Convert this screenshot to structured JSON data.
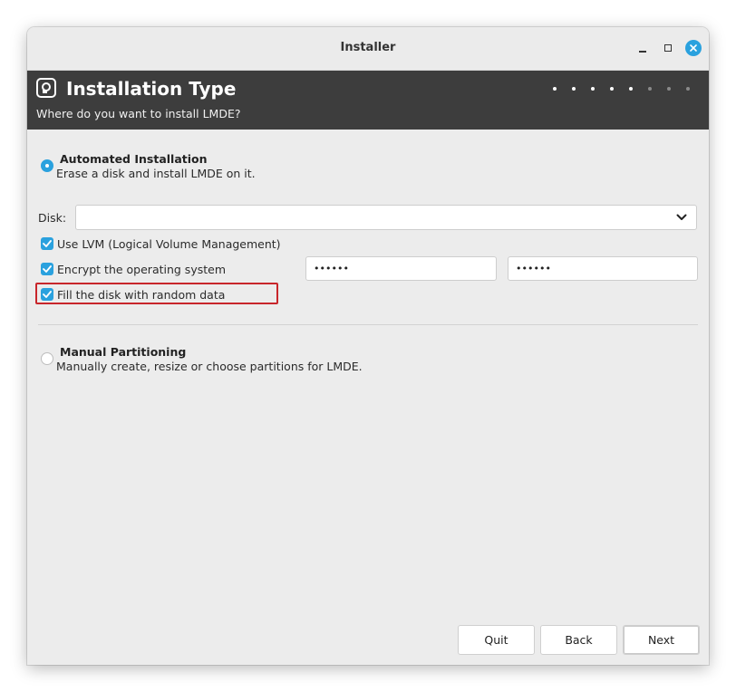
{
  "window": {
    "title": "Installer"
  },
  "header": {
    "title": "Installation Type",
    "subtitle": "Where do you want to install LMDE?",
    "progress": {
      "total_steps": 8,
      "completed_steps": 5
    }
  },
  "automated": {
    "title": "Automated Installation",
    "description": "Erase a disk and install LMDE on it.",
    "selected": true
  },
  "disk": {
    "label": "Disk:",
    "value": ""
  },
  "options": {
    "lvm_label": "Use LVM (Logical Volume Management)",
    "lvm_checked": true,
    "encrypt_label": "Encrypt the operating system",
    "encrypt_checked": true,
    "password_value": "••••••",
    "password_confirm_value": "••••••",
    "fill_label": "Fill the disk with random data",
    "fill_checked": true
  },
  "manual": {
    "title": "Manual Partitioning",
    "description": "Manually create, resize or choose partitions for LMDE.",
    "selected": false
  },
  "buttons": {
    "quit": "Quit",
    "back": "Back",
    "next": "Next"
  },
  "colors": {
    "accent": "#2aa1de",
    "header_bg": "#3d3d3d",
    "highlight": "#c8262b"
  }
}
